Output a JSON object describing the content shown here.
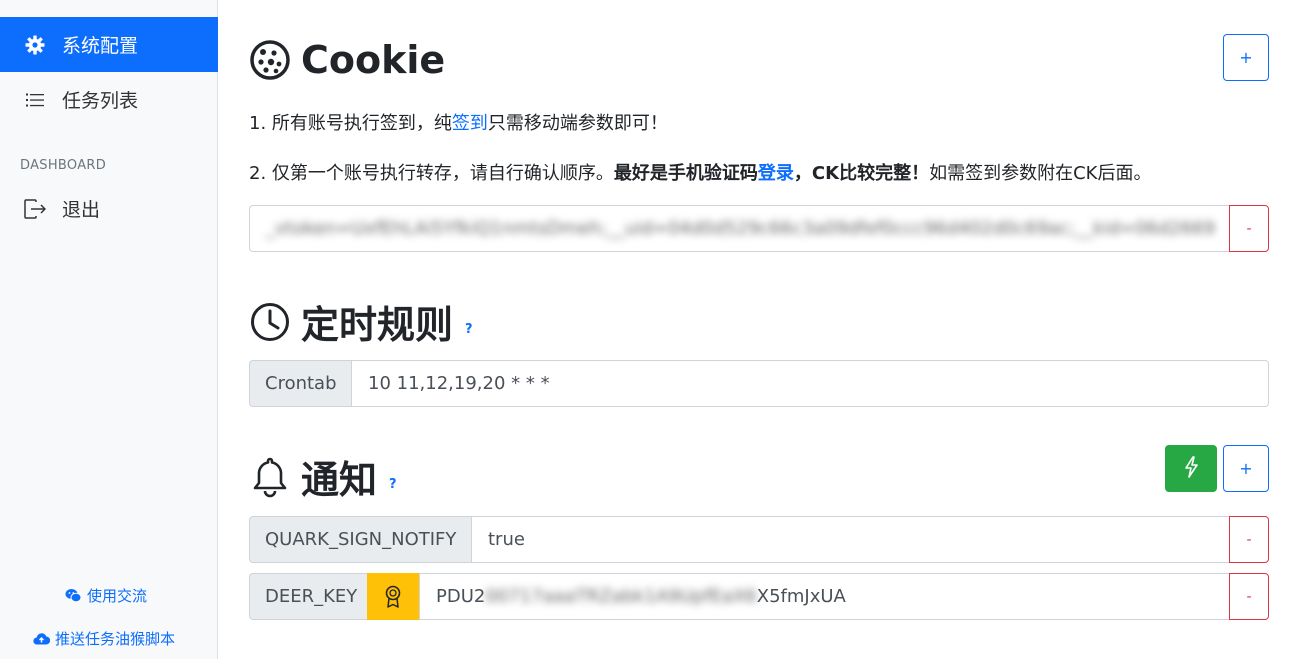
{
  "sidebar": {
    "items": [
      {
        "label": "系统配置",
        "icon": "gear-icon",
        "active": true
      },
      {
        "label": "任务列表",
        "icon": "list-icon",
        "active": false
      }
    ],
    "heading": "DASHBOARD",
    "logout_label": "退出",
    "footer_links": [
      {
        "label": "使用交流",
        "icon": "wechat-icon"
      },
      {
        "label": "推送任务油猴脚本",
        "icon": "cloud-upload-icon"
      }
    ]
  },
  "cookie_section": {
    "title": "Cookie",
    "add_label": "+",
    "note1_prefix": "1. 所有账号执行签到，纯",
    "note1_link": "签到",
    "note1_suffix": "只需移动端参数即可！",
    "note2_prefix": "2. 仅第一个账号执行转存，请自行确认顺序。",
    "note2_bold1": "最好是手机验证码",
    "note2_link": "登录",
    "note2_bold2": "，CK比较完整！",
    "note2_suffix": "如需签到参数附在CK后面。",
    "cookie_value": "_vtoken=UxfEhLAi5YfkiQ1nmtsDmeh;__uid=04d0d529c66c3a09dfef0ccc96d402d0c69ac;__kid=06d2669",
    "remove_label": "-"
  },
  "schedule_section": {
    "title": "定时规则",
    "help": "?",
    "crontab_label": "Crontab",
    "crontab_value": "10 11,12,19,20 * * *"
  },
  "notify_section": {
    "title": "通知",
    "help": "?",
    "add_label": "+",
    "rows": [
      {
        "key": "QUARK_SIGN_NOTIFY",
        "value": "true",
        "remove_label": "-"
      },
      {
        "key": "DEER_KEY",
        "value_visible_prefix": "PDU2",
        "value_blurred": "00717aaaTRZabk1A9UpfEaX6",
        "value_visible_suffix": "X5fmJxUA",
        "remove_label": "-"
      }
    ]
  }
}
